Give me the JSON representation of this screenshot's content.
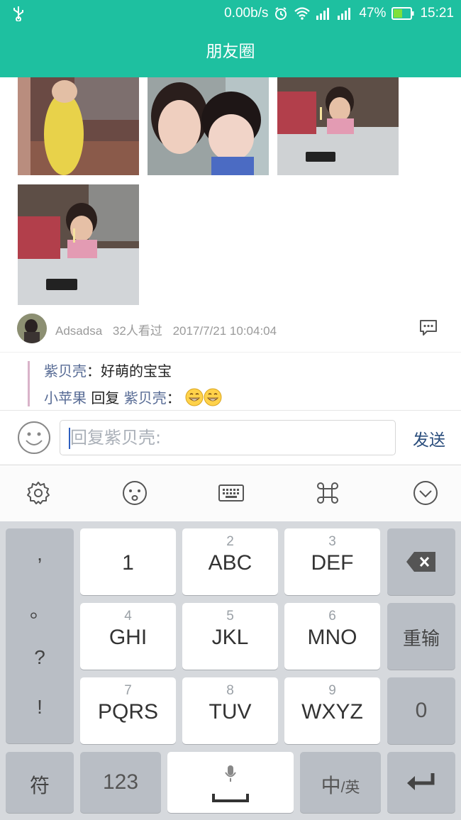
{
  "status_bar": {
    "net_speed": "0.00b/s",
    "battery": "47%",
    "time": "15:21"
  },
  "title": "朋友圈",
  "post": {
    "author": "Adsadsa",
    "views": "32人看过",
    "timestamp": "2017/7/21 10:04:04"
  },
  "comments": [
    {
      "name": "紫贝壳",
      "sep": "：",
      "text": "好萌的宝宝"
    },
    {
      "name": "小苹果",
      "reply_word": " 回复 ",
      "target": "紫贝壳",
      "sep": "：",
      "text": ""
    }
  ],
  "reply_input": {
    "placeholder": "回复紫贝壳:",
    "send_label": "发送"
  },
  "keyboard": {
    "punct": [
      ",",
      "。",
      "?",
      "!"
    ],
    "keys": [
      {
        "sub": "",
        "main": "1"
      },
      {
        "sub": "2",
        "main": "ABC"
      },
      {
        "sub": "3",
        "main": "DEF"
      },
      {
        "sub": "4",
        "main": "GHI"
      },
      {
        "sub": "5",
        "main": "JKL"
      },
      {
        "sub": "6",
        "main": "MNO"
      },
      {
        "sub": "7",
        "main": "PQRS"
      },
      {
        "sub": "8",
        "main": "TUV"
      },
      {
        "sub": "9",
        "main": "WXYZ"
      }
    ],
    "reenter": "重输",
    "zero": "0",
    "symbols": "符",
    "num": "123",
    "lang_main": "中",
    "lang_sub": "/英"
  },
  "colors": {
    "header": "#1ec0a0",
    "link": "#576b95",
    "send": "#2a4d7c"
  }
}
